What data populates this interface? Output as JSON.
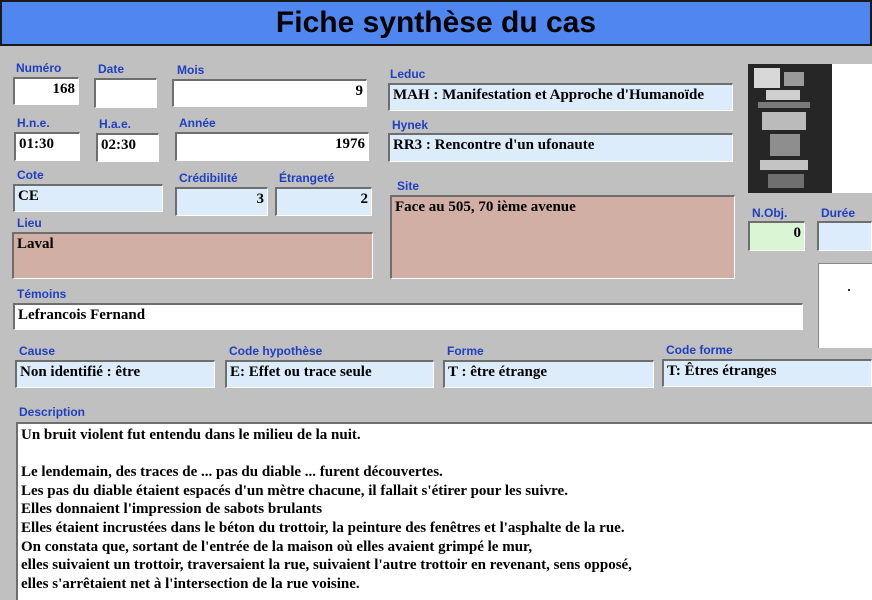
{
  "title": "Fiche synthèse du cas",
  "labels": {
    "numero": "Numéro",
    "date": "Date",
    "mois": "Mois",
    "leduc": "Leduc",
    "hne": "H.n.e.",
    "hae": "H.a.e.",
    "annee": "Année",
    "hynek": "Hynek",
    "cote": "Cote",
    "credibilite": "Crédibilité",
    "etrangete": "Étrangeté",
    "site": "Site",
    "lieu": "Lieu",
    "nobj": "N.Obj.",
    "duree": "Durée",
    "temoins": "Témoins",
    "cause": "Cause",
    "code_hypothese": "Code hypothèse",
    "forme": "Forme",
    "code_forme": "Code forme",
    "description": "Description"
  },
  "values": {
    "numero": "168",
    "date": "",
    "mois": "9",
    "leduc": "MAH : Manifestation et Approche d'Humanoïde",
    "hne": "01:30",
    "hae": "02:30",
    "annee": "1976",
    "hynek": "RR3 : Rencontre d'un ufonaute",
    "cote": "CE",
    "credibilite": "3",
    "etrangete": "2",
    "site": "Face au 505, 70 ième avenue",
    "lieu": "Laval",
    "nobj": "0",
    "duree": "",
    "temoins": "Lefrancois Fernand",
    "cause": "Non identifié : être",
    "code_hypothese": "E: Effet ou trace seule",
    "forme": "T : être étrange",
    "code_forme": "T: Êtres étranges"
  },
  "description_lines": [
    "Un bruit violent fut entendu dans le milieu de la nuit.",
    "",
    "Le lendemain, des traces de ...  pas du diable  ...  furent découvertes.",
    "Les pas du diable étaient espacés d'un mètre chacune, il fallait s'étirer pour les suivre.",
    "Elles donnaient l'impression de sabots brulants",
    "Elles étaient incrustées dans le béton du trottoir, la peinture des fenêtres et l'asphalte de la rue.",
    "On constata que, sortant de l'entrée de la maison où elles avaient grimpé le mur,",
    "elles suivaient un trottoir, traversaient la rue, suivaient l'autre trottoir en revenant, sens opposé,",
    "elles s'arrêtaient net à l'intersection de la rue voisine."
  ],
  "colors": {
    "title_bar": "#4f86f0",
    "label_text": "#1f3fbf",
    "field_blue": "#dcecfb",
    "field_pink": "#d1afa4",
    "field_green": "#d9f5d4",
    "background": "#c0c0c0"
  },
  "icons": {
    "photo": "case-photo",
    "sketch": "case-sketch"
  }
}
